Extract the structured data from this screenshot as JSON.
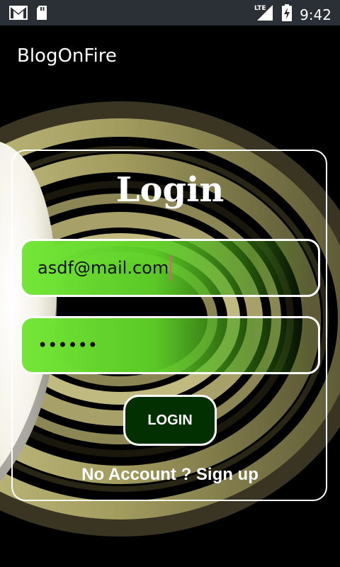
{
  "status_bar": {
    "time": "9:42",
    "network": "LTE",
    "icons": [
      "gmail-icon",
      "sd-card-icon",
      "lte-signal-icon",
      "battery-icon"
    ]
  },
  "app_bar": {
    "title": "BlogOnFire"
  },
  "login_form": {
    "title": "Login",
    "email_value": "asdf@mail.com",
    "password_value": "••••••",
    "login_button": "LOGIN",
    "signup_link": "No Account ? Sign up"
  },
  "colors": {
    "field_green": "#73e637",
    "button_bg": "#023000",
    "status_bar_bg": "#2b2f36",
    "caret": "#d9607a"
  }
}
